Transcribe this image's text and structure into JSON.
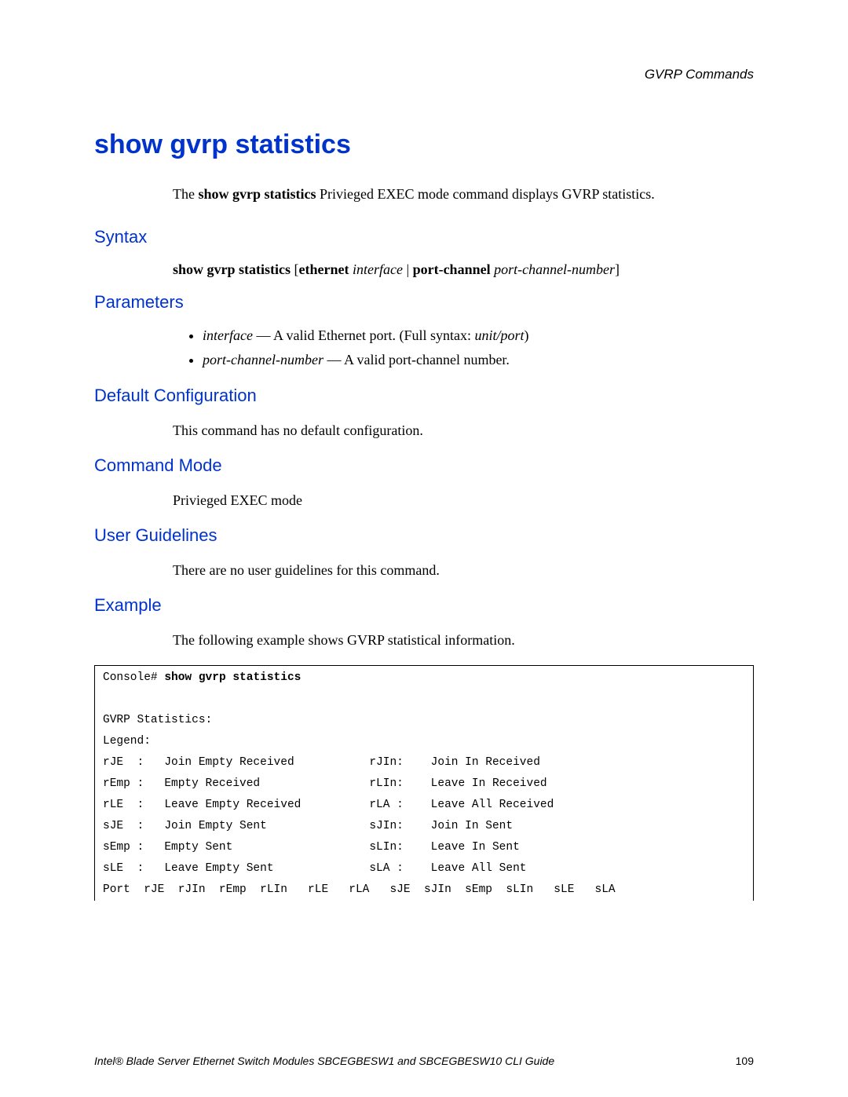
{
  "runningHeader": "GVRP Commands",
  "title": "show gvrp statistics",
  "lead": {
    "pre": "The ",
    "cmd": "show gvrp statistics",
    "post": " Privieged EXEC mode command displays GVRP statistics."
  },
  "sections": {
    "syntax": {
      "heading": "Syntax",
      "kw1": "show gvrp statistics",
      "br1": " [",
      "kw2": "ethernet",
      "sp1": " ",
      "arg1": "interface",
      "pipe": " | ",
      "kw3": "port-channel",
      "sp2": " ",
      "arg2": "port-channel-number",
      "br2": "]"
    },
    "parameters": {
      "heading": "Parameters",
      "items": [
        {
          "name": "interface",
          "dash": " — ",
          "desc_a": "A valid Ethernet port. (Full syntax: ",
          "desc_i": "unit/port",
          "desc_b": ")"
        },
        {
          "name": "port-channel-number",
          "dash": " — ",
          "desc_a": "A valid port-channel number.",
          "desc_i": "",
          "desc_b": ""
        }
      ]
    },
    "defaultConfig": {
      "heading": "Default Configuration",
      "text": "This command has no default configuration."
    },
    "commandMode": {
      "heading": "Command Mode",
      "text": "Privieged EXEC mode"
    },
    "userGuidelines": {
      "heading": "User Guidelines",
      "text": "There are no user guidelines for this command."
    },
    "example": {
      "heading": "Example",
      "lead": "The following example shows GVRP statistical information.",
      "prompt": "Console# ",
      "cmd": "show gvrp statistics",
      "lines": [
        "",
        "GVRP Statistics:",
        "Legend:",
        "rJE  :   Join Empty Received           rJIn:    Join In Received",
        "rEmp :   Empty Received                rLIn:    Leave In Received",
        "rLE  :   Leave Empty Received          rLA :    Leave All Received",
        "sJE  :   Join Empty Sent               sJIn:    Join In Sent",
        "sEmp :   Empty Sent                    sLIn:    Leave In Sent",
        "sLE  :   Leave Empty Sent              sLA :    Leave All Sent",
        "Port  rJE  rJIn  rEmp  rLIn   rLE   rLA   sJE  sJIn  sEmp  sLIn   sLE   sLA"
      ]
    }
  },
  "footer": {
    "text": "Intel® Blade Server Ethernet Switch Modules SBCEGBESW1 and SBCEGBESW10 CLI Guide",
    "page": "109"
  }
}
